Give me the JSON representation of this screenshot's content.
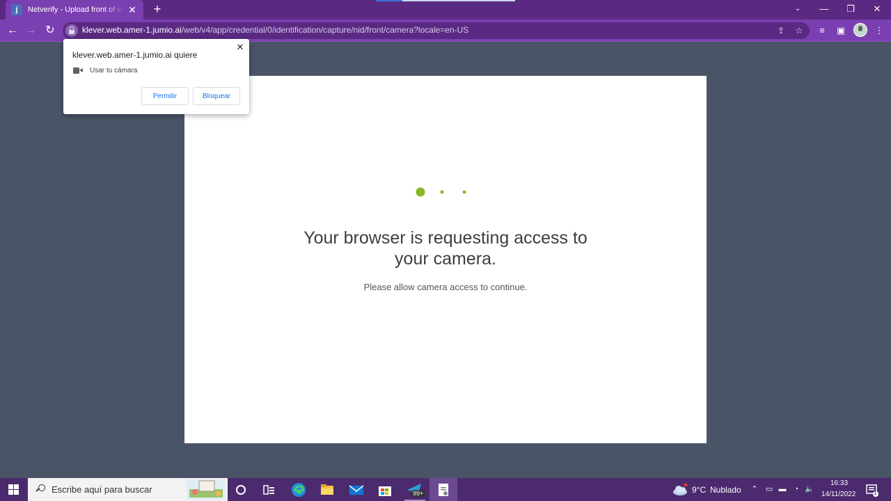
{
  "browser": {
    "tab": {
      "favicon_letter": "j",
      "title": "Netverify - Upload front of identity document"
    },
    "url": {
      "host": "klever.web.amer-1.jumio.ai",
      "path": "/web/v4/app/credential/0/identification/capture/nid/front/camera?locale=en-US"
    }
  },
  "permission_popup": {
    "title": "klever.web.amer-1.jumio.ai quiere",
    "permission": "Usar tu cámara",
    "allow_label": "Permitir",
    "block_label": "Bloquear"
  },
  "page": {
    "heading": "Your browser is requesting access to your camera.",
    "subtext": "Please allow camera access to continue.",
    "accent_color": "#8cb52a"
  },
  "taskbar": {
    "search_placeholder": "Escribe aquí para buscar",
    "badge": "99+",
    "weather": {
      "temp": "9°C",
      "condition": "Nublado"
    },
    "clock": {
      "time": "16:33",
      "date": "14/11/2022"
    },
    "notification_count": "1"
  }
}
